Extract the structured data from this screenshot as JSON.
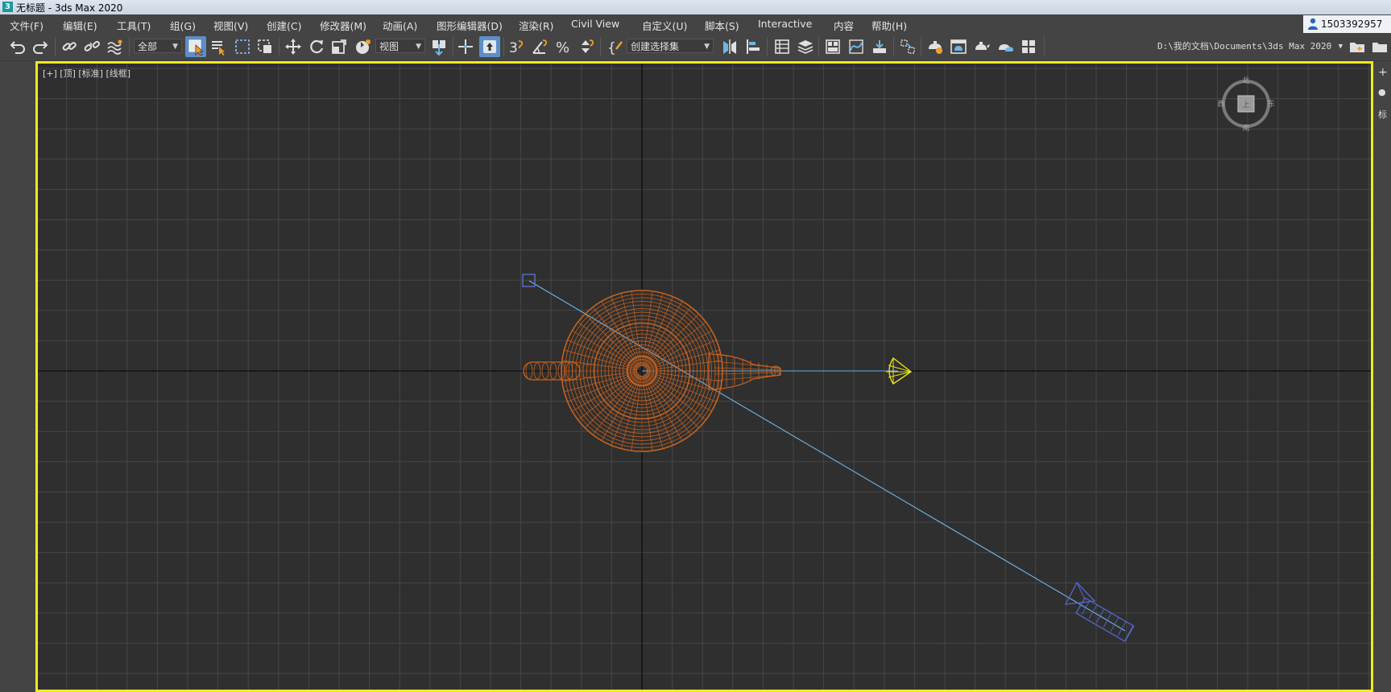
{
  "window": {
    "title": "无标题 - 3ds Max 2020",
    "app_icon_letter": "3"
  },
  "menu": [
    "文件(F)",
    "编辑(E)",
    "工具(T)",
    "组(G)",
    "视图(V)",
    "创建(C)",
    "修改器(M)",
    "动画(A)",
    "图形编辑器(D)",
    "渲染(R)",
    "Civil View",
    "自定义(U)",
    "脚本(S)",
    "Interactive",
    "内容",
    "帮助(H)"
  ],
  "user": {
    "name": "1503392957",
    "icon": "user-icon"
  },
  "toolbar": {
    "selection_filter": "全部",
    "reference_coord": "视图",
    "named_selection_set": "创建选择集",
    "project_path": "D:\\我的文档\\Documents\\3ds Max 2020",
    "active_tool": "select-object-button",
    "icons": [
      "undo-icon",
      "redo-icon",
      "link-icon",
      "unlink-icon",
      "bind-space-warp-icon",
      "select-object-icon",
      "select-by-name-icon",
      "rectangular-selection-icon",
      "window-crossing-icon",
      "move-icon",
      "rotate-icon",
      "scale-icon",
      "placement-icon",
      "pivot-icon",
      "keyboard-shortcut-icon",
      "snap-3d-icon",
      "angle-snap-icon",
      "percent-snap-icon",
      "spinner-snap-icon",
      "edit-named-selection-icon",
      "mirror-icon",
      "align-icon",
      "scene-explorer-icon",
      "layer-explorer-icon",
      "toggle-ribbon-icon",
      "curve-editor-icon",
      "schematic-view-icon",
      "material-editor-icon",
      "render-setup-icon",
      "rendered-frame-window-icon",
      "render-production-icon",
      "render-cloud-icon",
      "project-folder-icon"
    ]
  },
  "viewport": {
    "label": "[+] [顶] [标准] [线框]",
    "view": "top",
    "style": "wireframe",
    "active": true,
    "border_color": "#f2ea1c",
    "background_color": "#2f2f2f",
    "viewcube": {
      "north": "北",
      "south": "南",
      "east": "东",
      "west": "西",
      "face": "上"
    }
  },
  "scene": {
    "teapot_color": "#c8621e",
    "light_color": "#e8e01c",
    "camera_color": "#5566cc",
    "target_line_color": "#6fb6e8"
  },
  "right_panel": {
    "items": [
      "+",
      "●",
      "标"
    ]
  }
}
